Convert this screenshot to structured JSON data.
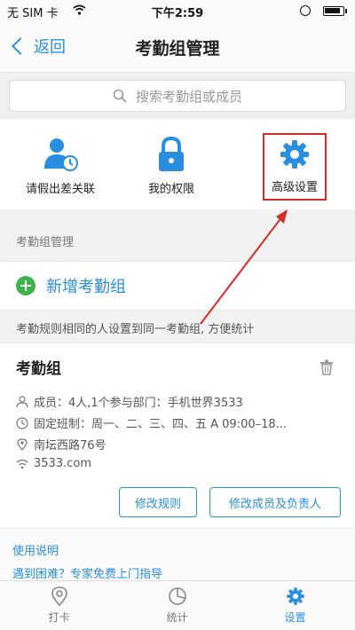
{
  "status_bar": {
    "carrier": "无 SIM 卡",
    "time": "下午2:59"
  },
  "nav": {
    "back_label": "返回",
    "title": "考勤组管理"
  },
  "search": {
    "placeholder": "搜索考勤组或成员"
  },
  "quick_actions": [
    {
      "label": "请假出差关联",
      "icon": "user-clock-icon"
    },
    {
      "label": "我的权限",
      "icon": "lock-icon"
    },
    {
      "label": "高级设置",
      "icon": "gear-icon",
      "highlighted": true
    }
  ],
  "section_label": "考勤组管理",
  "add_group_label": "新增考勤组",
  "hint": "考勤规则相同的人设置到同一考勤组, 方便统计",
  "group_card": {
    "name": "考勤组",
    "members": "成员：4人,1个参与部门：手机世界3533",
    "schedule": "固定班制：周一、二、三、四、五 A 09:00–18...",
    "location": "南坛西路76号",
    "wifi": "3533.com",
    "edit_rules": "修改规则",
    "edit_members": "修改成员及负责人"
  },
  "help": {
    "title": "使用说明",
    "link": "遇到困难？专家免费上门指导"
  },
  "tabs": [
    {
      "label": "打卡",
      "icon": "location-icon",
      "active": false
    },
    {
      "label": "统计",
      "icon": "chart-icon",
      "active": false
    },
    {
      "label": "设置",
      "icon": "gear-icon",
      "active": true
    }
  ],
  "colors": {
    "accent": "#2a8ee0",
    "add_green": "#3db34a",
    "highlight_red": "#d62b2b"
  }
}
